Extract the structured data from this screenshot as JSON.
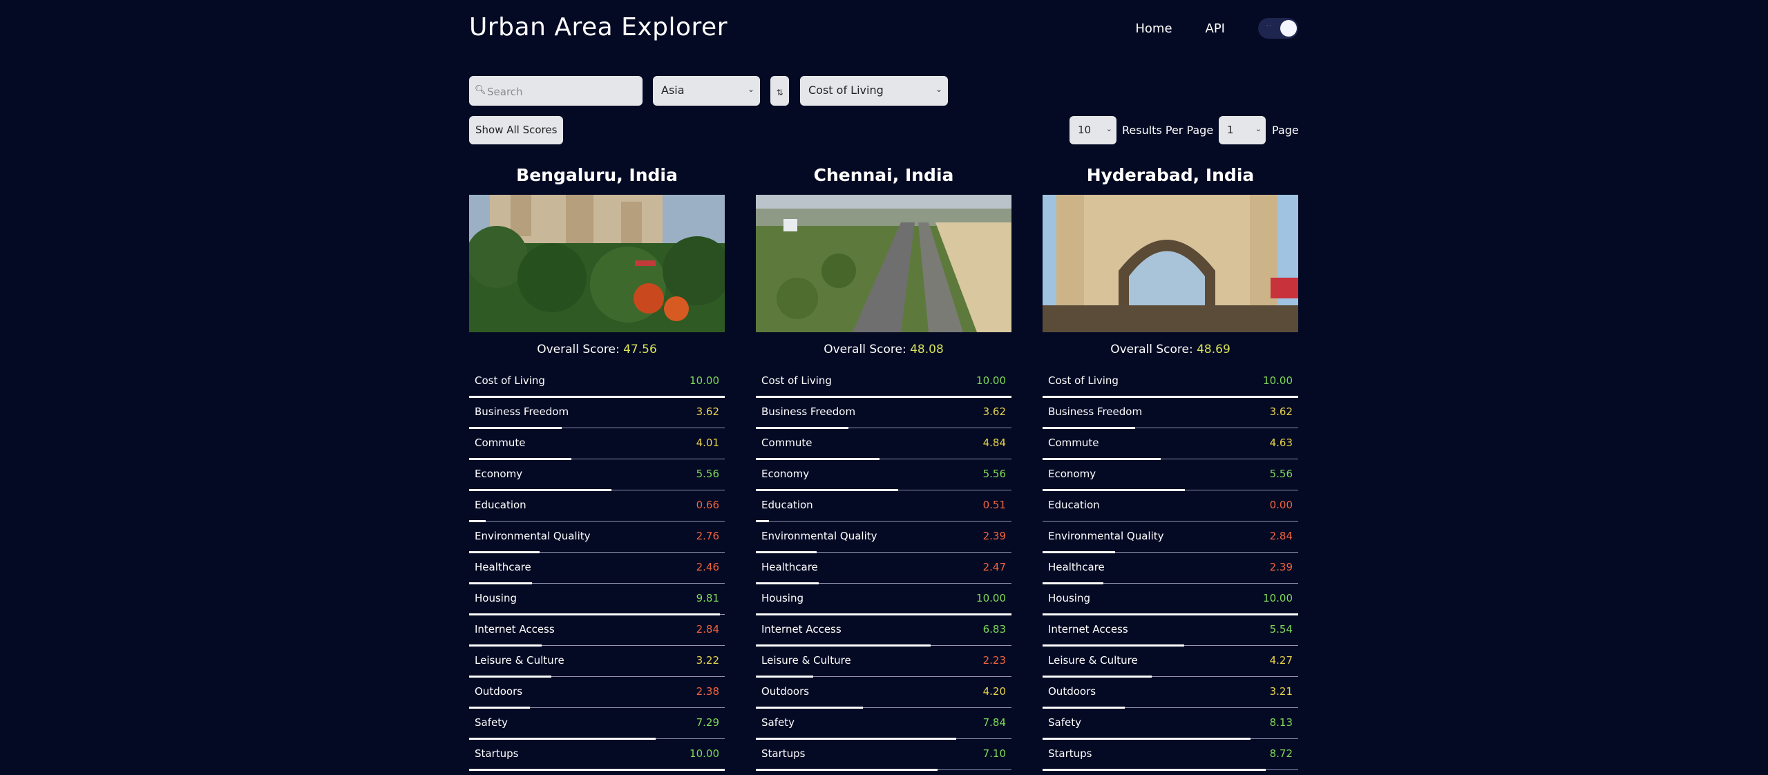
{
  "app": {
    "title": "Urban Area Explorer"
  },
  "nav": {
    "home": "Home",
    "api": "API"
  },
  "search": {
    "placeholder": "Search"
  },
  "filters": {
    "region": "Asia",
    "sort_icon": "sort-icon",
    "category": "Cost of Living",
    "show_all": "Show All Scores",
    "results_per_page": "10",
    "results_per_page_label": "Results Per Page",
    "page": "1",
    "page_label": "Page"
  },
  "overall_label": "Overall Score:",
  "cities": [
    {
      "name": "Bengaluru, India",
      "overall": "47.56",
      "scores": [
        {
          "label": "Cost of Living",
          "value": "10.00"
        },
        {
          "label": "Business Freedom",
          "value": "3.62"
        },
        {
          "label": "Commute",
          "value": "4.01"
        },
        {
          "label": "Economy",
          "value": "5.56"
        },
        {
          "label": "Education",
          "value": "0.66"
        },
        {
          "label": "Environmental Quality",
          "value": "2.76"
        },
        {
          "label": "Healthcare",
          "value": "2.46"
        },
        {
          "label": "Housing",
          "value": "9.81"
        },
        {
          "label": "Internet Access",
          "value": "2.84"
        },
        {
          "label": "Leisure & Culture",
          "value": "3.22"
        },
        {
          "label": "Outdoors",
          "value": "2.38"
        },
        {
          "label": "Safety",
          "value": "7.29"
        },
        {
          "label": "Startups",
          "value": "10.00"
        }
      ]
    },
    {
      "name": "Chennai, India",
      "overall": "48.08",
      "scores": [
        {
          "label": "Cost of Living",
          "value": "10.00"
        },
        {
          "label": "Business Freedom",
          "value": "3.62"
        },
        {
          "label": "Commute",
          "value": "4.84"
        },
        {
          "label": "Economy",
          "value": "5.56"
        },
        {
          "label": "Education",
          "value": "0.51"
        },
        {
          "label": "Environmental Quality",
          "value": "2.39"
        },
        {
          "label": "Healthcare",
          "value": "2.47"
        },
        {
          "label": "Housing",
          "value": "10.00"
        },
        {
          "label": "Internet Access",
          "value": "6.83"
        },
        {
          "label": "Leisure & Culture",
          "value": "2.23"
        },
        {
          "label": "Outdoors",
          "value": "4.20"
        },
        {
          "label": "Safety",
          "value": "7.84"
        },
        {
          "label": "Startups",
          "value": "7.10"
        }
      ]
    },
    {
      "name": "Hyderabad, India",
      "overall": "48.69",
      "scores": [
        {
          "label": "Cost of Living",
          "value": "10.00"
        },
        {
          "label": "Business Freedom",
          "value": "3.62"
        },
        {
          "label": "Commute",
          "value": "4.63"
        },
        {
          "label": "Economy",
          "value": "5.56"
        },
        {
          "label": "Education",
          "value": "0.00"
        },
        {
          "label": "Environmental Quality",
          "value": "2.84"
        },
        {
          "label": "Healthcare",
          "value": "2.39"
        },
        {
          "label": "Housing",
          "value": "10.00"
        },
        {
          "label": "Internet Access",
          "value": "5.54"
        },
        {
          "label": "Leisure & Culture",
          "value": "4.27"
        },
        {
          "label": "Outdoors",
          "value": "3.21"
        },
        {
          "label": "Safety",
          "value": "8.13"
        },
        {
          "label": "Startups",
          "value": "8.72"
        }
      ]
    }
  ],
  "colors": {
    "background": "#050a24",
    "high": "#7ed957",
    "mid": "#e5d24a",
    "low": "#f0633d",
    "overall": "#d7e35b"
  }
}
